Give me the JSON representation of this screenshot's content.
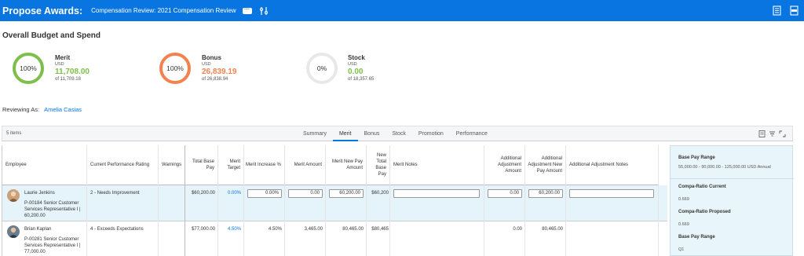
{
  "header": {
    "title": "Propose Awards:",
    "subtitle": "Compensation Review: 2021 Compensation Review",
    "more_label": "···",
    "colors": {
      "bar": "#0875e1"
    }
  },
  "budget": {
    "title": "Overall Budget and Spend",
    "gauges": [
      {
        "name": "Merit",
        "currency": "USD",
        "amount": "11,708.00",
        "of": "of 11,709.18",
        "pct_label": "100%",
        "fraction": 1.0,
        "color": "#7cc04b"
      },
      {
        "name": "Bonus",
        "currency": "USD",
        "amount": "26,839.19",
        "of": "of 26,838.94",
        "pct_label": "100%",
        "fraction": 1.0,
        "color": "#f4824f"
      },
      {
        "name": "Stock",
        "currency": "USD",
        "amount": "0.00",
        "of": "of 18,357.65",
        "pct_label": "0%",
        "fraction": 0.0,
        "color": "#7cc04b"
      }
    ]
  },
  "reviewing": {
    "label": "Reviewing As:",
    "name": "Amelia Casias"
  },
  "grid": {
    "count": "5 items",
    "tabs": [
      "Summary",
      "Merit",
      "Bonus",
      "Stock",
      "Promotion",
      "Performance"
    ],
    "active_tab": "Merit",
    "columns": {
      "employee": "Employee",
      "rating": "Current Performance Rating",
      "warnings": "Warnings",
      "total_base": "Total Base Pay",
      "merit_target": "Merit Target",
      "merit_increase": "Merit Increase %",
      "merit_amount": "Merit Amount",
      "merit_new_pay": "Merit New Pay Amount",
      "new_total_base": "New Total Base Pay",
      "merit_notes": "Merit Notes",
      "add_adj_amount": "Additional Adjustment Amount",
      "add_adj_new_pay": "Additional Adjustment New Pay Amount",
      "add_adj_notes": "Additional Adjustment Notes"
    },
    "rows": [
      {
        "name": "Laurie Jenkins",
        "position": "P-00184 Senior Customer Services Representative I",
        "salary": "60,200.00",
        "rating": "2 - Needs Improvement",
        "total_base": "$60,200.00",
        "merit_target": "0.00%",
        "merit_increase": "0.00%",
        "merit_amount": "0.00",
        "merit_new_pay": "60,200.00",
        "new_total_base": "$60,200",
        "add_adj_amount": "0.00",
        "add_adj_new_pay": "60,200.00"
      },
      {
        "name": "Brian Kaplan",
        "position": "P-00281 Senior Customer Services Representative I",
        "salary": "77,000.00",
        "rating": "4 - Exceeds Expectations",
        "total_base": "$77,000.00",
        "merit_target": "4.50%",
        "merit_increase": "4.50%",
        "merit_amount": "3,465.00",
        "merit_new_pay": "80,465.00",
        "new_total_base": "$80,465",
        "add_adj_amount": "0.00",
        "add_adj_new_pay": "80,465.00"
      }
    ]
  },
  "side_panel": {
    "base_pay_range_label": "Base Pay Range",
    "base_pay_range_value": "55,000.00 - 90,000.00 - 125,000.00 USD Annual",
    "compa_current_label": "Compa-Ratio Current",
    "compa_current_value": "0.669",
    "compa_proposed_label": "Compa-Ratio Proposed",
    "compa_proposed_value": "0.669",
    "base_pay_range2_label": "Base Pay Range",
    "base_pay_range2_value": "Q1"
  }
}
